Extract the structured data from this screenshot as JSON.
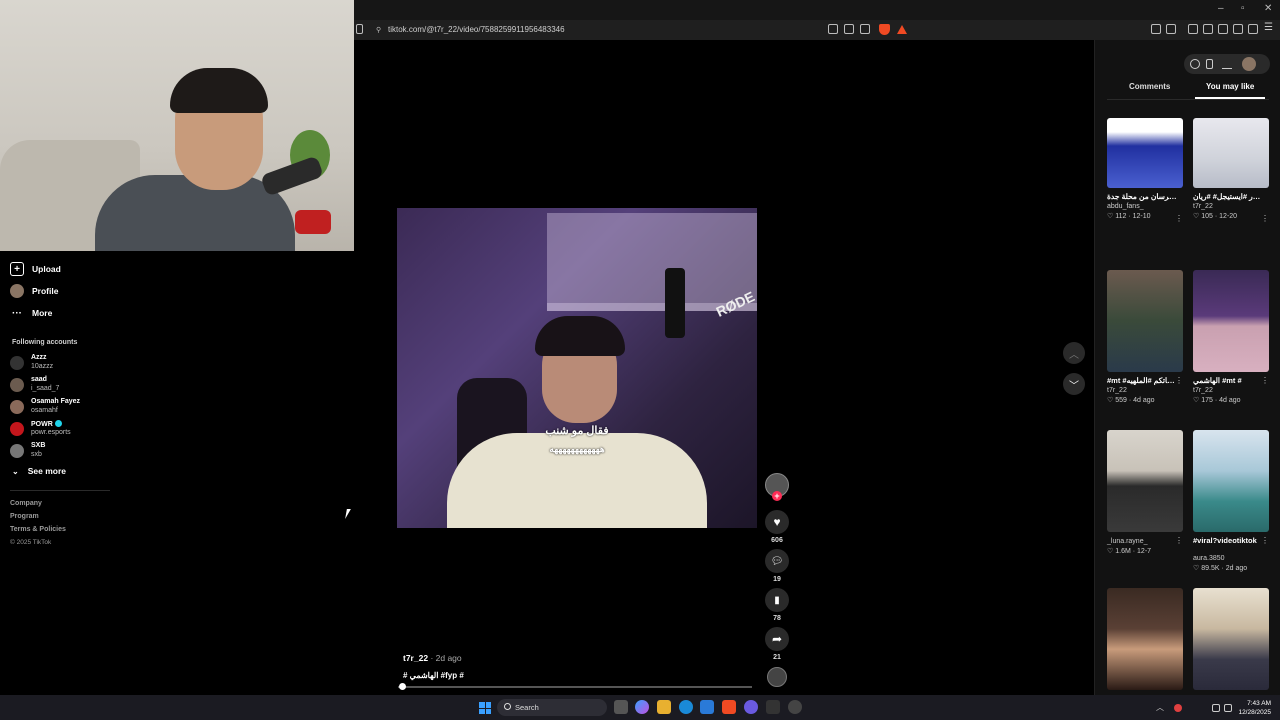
{
  "browser": {
    "url": "tiktok.com/@t7r_22/video/7588259911956483346"
  },
  "sidebar": {
    "items": [
      {
        "label": "Upload"
      },
      {
        "label": "Profile"
      },
      {
        "label": "More"
      }
    ],
    "following_title": "Following accounts",
    "accounts": [
      {
        "name": "Azzz",
        "handle": "10azzz"
      },
      {
        "name": "saad",
        "handle": "i_saad_7"
      },
      {
        "name": "Osamah Fayez",
        "handle": "osamahf"
      },
      {
        "name": "POWR",
        "handle": "powr.esports",
        "verified": true
      },
      {
        "name": "SXB",
        "handle": "sxb"
      }
    ],
    "see_more": "See more",
    "footer": {
      "company": "Company",
      "program": "Program",
      "terms": "Terms & Policies",
      "copyright": "© 2025 TikTok"
    }
  },
  "video": {
    "brand_on_mic": "RØDE",
    "caption_line1": "فقال مو شنب",
    "caption_line2": "ههههههههههههه",
    "author": "t7r_22",
    "date": "· 2d ago",
    "hashtags": "# الهاشمي #fyp #",
    "progress": 0.01
  },
  "actions": {
    "likes": "606",
    "comments": "19",
    "saves": "78",
    "shares": "21"
  },
  "right_panel": {
    "tabs": [
      "Comments",
      "You may like"
    ],
    "active_tab": "You may like",
    "cards": [
      {
        "title": "تهزهني الجلالة وانا اذ ...فرسان من محلة جدة",
        "user": "abdu_fans_",
        "likes": "112",
        "date": "12-10"
      },
      {
        "title": "كري #اتور #ايستيجل# #ريان",
        "user": "t7r_22",
        "likes": "105",
        "date": "12-20"
      },
      {
        "title": "#mt #ـيه# فاتكم #الملهيه",
        "user": "t7r_22",
        "likes": "559",
        "date": "4d ago"
      },
      {
        "title": "الهاشمي #mt #",
        "user": "t7r_22",
        "likes": "175",
        "date": "4d ago"
      },
      {
        "title": "",
        "user": "_luna.rayne_",
        "likes": "1.6M",
        "date": "12-7"
      },
      {
        "title": "#viral?videotiktok",
        "user": "aura.3850",
        "likes": "89.5K",
        "date": "2d ago"
      },
      {
        "title": "",
        "user": "",
        "likes": "",
        "date": ""
      },
      {
        "title": "",
        "user": "",
        "likes": "",
        "date": ""
      }
    ]
  },
  "taskbar": {
    "search_placeholder": "Search",
    "time": "7:43 AM",
    "date": "12/28/2025"
  },
  "colors": {
    "accent": "#fe2c55",
    "background": "#000000",
    "panel": "#121212"
  }
}
